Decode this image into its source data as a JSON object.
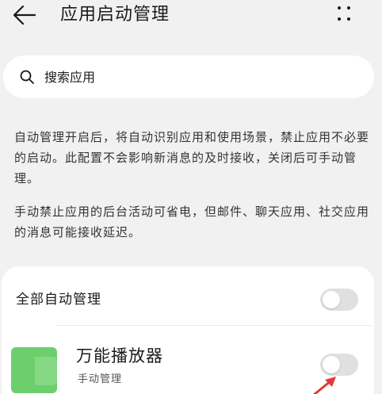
{
  "header": {
    "back_icon": "arrow-left-icon",
    "title": "应用启动管理",
    "more_icon": "more-dots-icon"
  },
  "search": {
    "icon": "search-icon",
    "placeholder": "搜索应用"
  },
  "descriptions": [
    "自动管理开启后，将自动识别应用和使用场景，禁止应用不必要的启动。此配置不会影响新消息的及时接收，关闭后可手动管理。",
    "手动禁止应用的后台活动可省电，但邮件、聊天应用、社交应用的消息可能接收延迟。"
  ],
  "all_auto": {
    "label": "全部自动管理",
    "enabled": false
  },
  "apps": [
    {
      "name": "万能播放器",
      "status": "手动管理",
      "enabled": false,
      "icon_color": "#6ccf6c"
    }
  ],
  "colors": {
    "background": "#f1f1f1",
    "card": "#ffffff",
    "toggle_off": "#e0e0e0",
    "annotation_arrow": "#e53935"
  }
}
